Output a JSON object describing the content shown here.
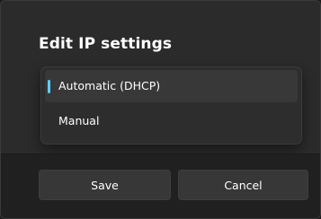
{
  "dialog": {
    "title": "Edit IP settings"
  },
  "dropdown": {
    "options": [
      {
        "label": "Automatic (DHCP)",
        "selected": true
      },
      {
        "label": "Manual",
        "selected": false
      }
    ],
    "accent_color": "#60cdff"
  },
  "footer": {
    "save_label": "Save",
    "cancel_label": "Cancel"
  }
}
